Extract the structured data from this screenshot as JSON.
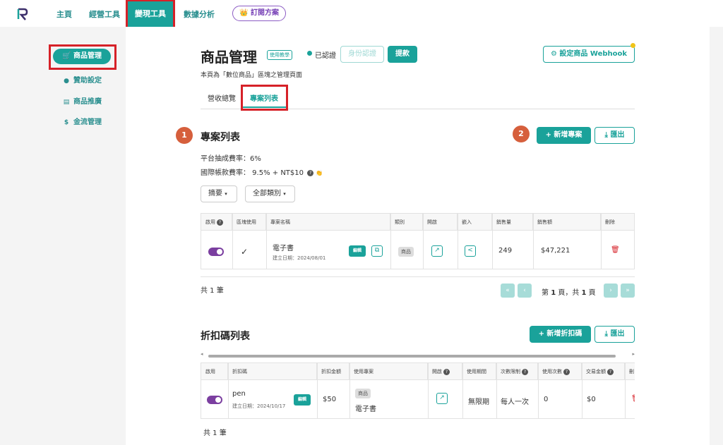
{
  "topnav": {
    "items": [
      "主頁",
      "經營工具",
      "變現工具",
      "數據分析"
    ],
    "plan_button": "👑 訂閱方案"
  },
  "sidebar": {
    "items": [
      {
        "icon": "cart-icon",
        "label": "商品管理"
      },
      {
        "icon": "coin-icon",
        "label": "贊助設定"
      },
      {
        "icon": "stack-icon",
        "label": "商品推廣"
      },
      {
        "icon": "dollar-icon",
        "label": "金流管理"
      }
    ]
  },
  "header": {
    "title": "商品管理",
    "tutorial_tag": "使用教學",
    "verified_text": "已認證",
    "identity_button": "身份認證",
    "withdraw_button": "提款",
    "webhook_button": "設定商品 Webhook",
    "subtitle": "本頁為「數位商品」區塊之管理頁面"
  },
  "tabs": [
    "營收總覽",
    "專案列表"
  ],
  "projects": {
    "badge1": "1",
    "badge2": "2",
    "title": "專案列表",
    "fee_line": "平台抽成費率：6%",
    "intl_fee_line": "國際帳款費率： 9.5% + NT$10",
    "add_button": "+ 新增專案",
    "export_button": "⤓ 匯出",
    "filter_summary": "摘要",
    "filter_category": "全部類別",
    "columns": [
      "啟用",
      "區塊使用",
      "專案名稱",
      "類別",
      "開啟",
      "嵌入",
      "銷售量",
      "銷售額",
      "刪除"
    ],
    "rows": [
      {
        "name": "電子書",
        "created": "建立日期：2024/08/01",
        "edit": "編輯",
        "category": "商品",
        "sales_count": "249",
        "sales_amount": "$47,221"
      }
    ],
    "total": "共 1 筆",
    "pager": {
      "prefix": "第 ",
      "page": "1",
      "mid": " 頁，共 ",
      "total": "1",
      "suffix": " 頁"
    }
  },
  "discounts": {
    "title": "折扣碼列表",
    "add_button": "+ 新增折扣碼",
    "export_button": "⤓ 匯出",
    "columns": [
      "啟用",
      "折扣碼",
      "折扣金額",
      "使用專案",
      "開啟",
      "使用期間",
      "次數限制",
      "使用次數",
      "交易金額",
      "刪"
    ],
    "rows": [
      {
        "code": "pen",
        "created": "建立日期：2024/10/17",
        "edit": "編輯",
        "amount": "$50",
        "project_tag": "商品",
        "project": "電子書",
        "period": "無限期",
        "limit": "每人一次",
        "used": "0",
        "trade": "$0"
      }
    ],
    "total": "共 1 筆"
  },
  "colors": {
    "accent": "#1aa29a",
    "highlight_box": "#d62128",
    "toggle": "#7b3fa0",
    "badge": "#d65f3c"
  }
}
